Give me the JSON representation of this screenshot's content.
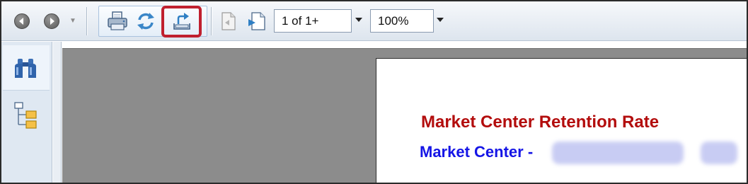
{
  "toolbar": {
    "page_indicator": "1 of 1+",
    "zoom_level": "100%",
    "buttons": [
      {
        "name": "back",
        "icon": "back-arrow-icon"
      },
      {
        "name": "forward",
        "icon": "forward-arrow-icon"
      },
      {
        "name": "print",
        "icon": "printer-icon"
      },
      {
        "name": "refresh",
        "icon": "refresh-icon"
      },
      {
        "name": "export",
        "icon": "export-icon",
        "highlighted": true
      },
      {
        "name": "previous-page",
        "icon": "page-previous-icon"
      },
      {
        "name": "next-page",
        "icon": "page-next-icon"
      }
    ],
    "highlight_color": "#c0202e"
  },
  "sidebar": {
    "items": [
      {
        "name": "find",
        "icon": "binoculars-icon",
        "active": true
      },
      {
        "name": "document-map",
        "icon": "tree-icon",
        "active": false
      }
    ]
  },
  "report": {
    "title": "Market Center Retention Rate",
    "subtitle_prefix": "Market Center -",
    "title_color": "#b30d0d",
    "subtitle_color": "#1515e6"
  }
}
